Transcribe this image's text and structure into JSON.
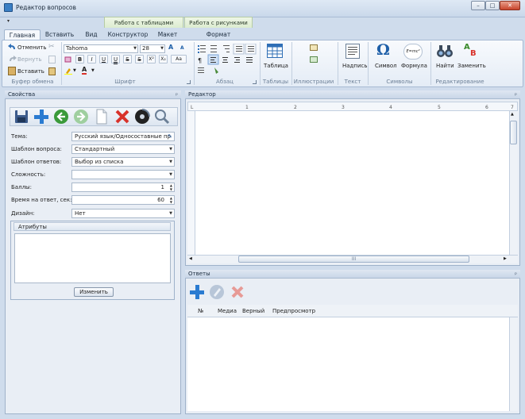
{
  "window": {
    "title": "Редактор вопросов",
    "min": "–",
    "max": "□",
    "close": "✕"
  },
  "quick_access": {
    "arrow": "▾"
  },
  "context_groups": {
    "tables": "Работа с таблицами",
    "images": "Работа с рисунками"
  },
  "tabs": [
    "Главная",
    "Вставить",
    "Вид",
    "Конструктор",
    "Макет",
    "Формат"
  ],
  "ribbon": {
    "clipboard": {
      "undo": "Отменить",
      "redo": "Вернуть",
      "paste": "Вставить",
      "label": "Буфер обмена"
    },
    "font": {
      "family": "Tahoma",
      "size": "28",
      "label": "Шрифт",
      "bold": "B",
      "italic": "I",
      "underline": "U",
      "double_underline": "U",
      "strike": "S",
      "strike2": "S",
      "superscript": "X²",
      "subscript": "X₂",
      "case": "Aa",
      "color": "A",
      "grow": "A",
      "shrink": "A"
    },
    "paragraph": {
      "label": "Абзац"
    },
    "tables": {
      "table": "Таблица",
      "label": "Таблицы"
    },
    "illustrations": {
      "label": "Иллюстрации"
    },
    "text": {
      "caption": "Надпись",
      "label": "Текст"
    },
    "symbols": {
      "symbol": "Символ",
      "formula": "Формула",
      "label": "Символы",
      "omega": "Ω",
      "formula_glyph": "E=mc²"
    },
    "editing": {
      "find": "Найти",
      "replace": "Заменить",
      "label": "Редактирование",
      "replace_a": "A",
      "replace_b": "B"
    }
  },
  "properties": {
    "title": "Свойства",
    "pin": "ᵖ",
    "fields": [
      {
        "label": "Тема:",
        "value": "Русский язык/Односоставные пр",
        "kind": "picker"
      },
      {
        "label": "Шаблон вопроса:",
        "value": "Стандартный",
        "kind": "combo"
      },
      {
        "label": "Шаблон ответов:",
        "value": "Выбор из списка",
        "kind": "combo"
      },
      {
        "label": "Сложность:",
        "value": "",
        "kind": "combo"
      },
      {
        "label": "Баллы:",
        "value": "1",
        "kind": "spin"
      },
      {
        "label": "Время на ответ, сек:",
        "value": "60",
        "kind": "spin"
      },
      {
        "label": "Дизайн:",
        "value": "Нет",
        "kind": "combo"
      }
    ],
    "attributes_tab": "Атрибуты",
    "change_button": "Изменить"
  },
  "editor": {
    "title": "Редактор",
    "pin": "ᵖ",
    "ruler_corner": "L",
    "ruler_numbers": [
      "1",
      "2",
      "3",
      "4",
      "5",
      "6",
      "7"
    ],
    "scroll_mid": "III"
  },
  "answers": {
    "title": "Ответы",
    "pin": "ᵖ",
    "columns": [
      "№",
      "Медиа",
      "Верный",
      "Предпросмотр"
    ]
  },
  "colors": {
    "accent": "#2a7bd1",
    "delete": "#d8322a"
  }
}
